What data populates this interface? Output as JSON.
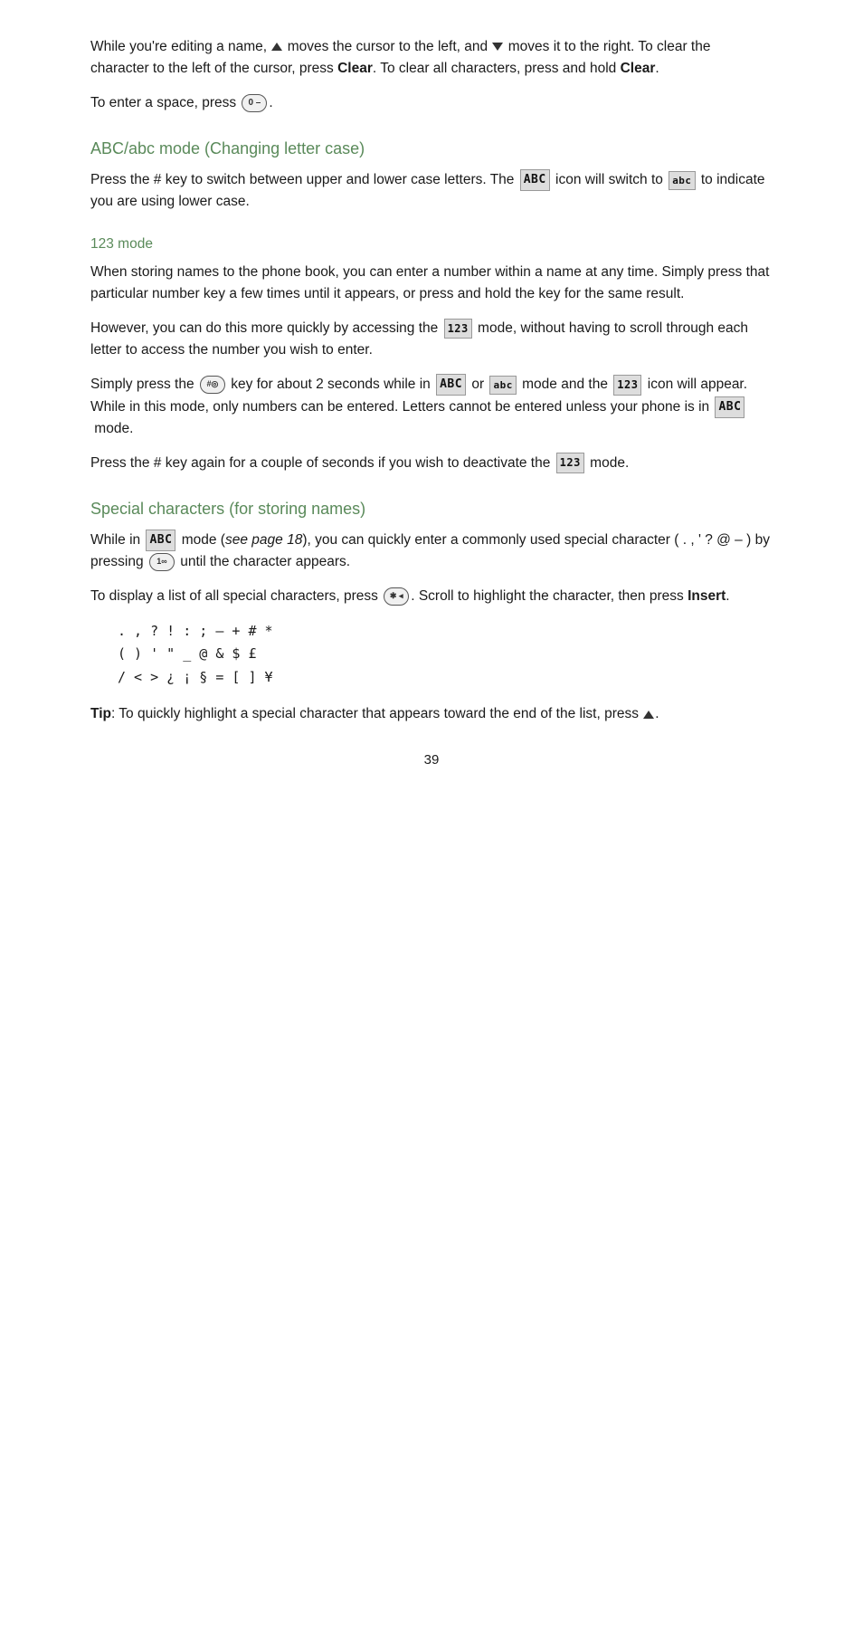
{
  "page": {
    "page_number": "39",
    "sections": [
      {
        "id": "intro",
        "paragraphs": [
          "While you're editing a name, ▲ moves the cursor to the left, and ▼ moves it to the right. To clear the character to the left of the cursor, press Clear. To clear all characters, press and hold Clear.",
          "To enter a space, press [0-key]."
        ]
      },
      {
        "id": "abc-mode",
        "heading": "ABC/abc mode (Changing letter case)",
        "heading_type": "h2",
        "paragraphs": [
          "Press the # key to switch between upper and lower case letters. The [ABC] icon will switch to [abc] to indicate you are using lower case."
        ]
      },
      {
        "id": "123-mode",
        "heading": "123 mode",
        "heading_type": "h3",
        "paragraphs": [
          "When storing names to the phone book, you can enter a number within a name at any time. Simply press that particular number key a few times until it appears, or press and hold the key for the same result.",
          "However, you can do this more quickly by accessing the [123] mode, without having to scroll through each letter to access the number you wish to enter.",
          "Simply press the [#-key] key for about 2 seconds while in [ABC] or [abc] mode and the [123] icon will appear. While in this mode, only numbers can be entered. Letters cannot be entered unless your phone is in [ABC] mode.",
          "Press the # key again for a couple of seconds if you wish to deactivate the [123] mode."
        ]
      },
      {
        "id": "special-chars",
        "heading": "Special characters (for storing names)",
        "heading_type": "h2",
        "paragraphs": [
          "While in [ABC] mode (see page 18), you can quickly enter a commonly used special character ( . , ' ? @ – ) by pressing [1-key] until the character appears.",
          "To display a list of all special characters, press [*-key]. Scroll to highlight the character, then press Insert."
        ],
        "char_table": [
          ". , ? ! : ; – + # *",
          "( ) ' \" _ @ & $ £",
          "/ < > ¿ ¡ § = [ ] ¥"
        ],
        "tip": "Tip: To quickly highlight a special character that appears toward the end of the list, press ▲."
      }
    ]
  }
}
